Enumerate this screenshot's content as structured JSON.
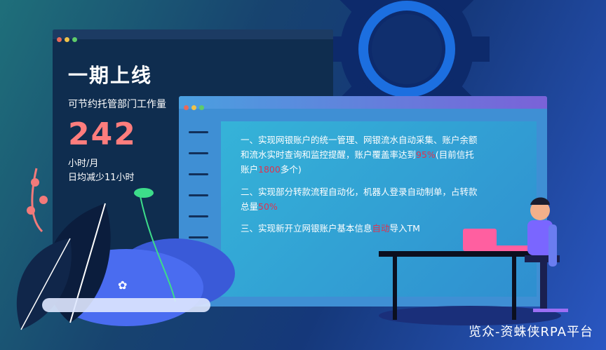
{
  "left_window": {
    "title": "一期上线",
    "subtitle": "可节约托管部门工作量",
    "big_number": "242",
    "unit": "小时/月",
    "daily": "日均减少11小时"
  },
  "right_window": {
    "item1_pre": "一、实现网银账户的统一管理、网银流水自动采集、账户余额和流水实时查询和监控提醒，账户覆盖率达到",
    "item1_hl1": "95%",
    "item1_mid": "(目前信托账户",
    "item1_hl2": "1800",
    "item1_post": "多个)",
    "item2_pre": "二、实现部分转款流程自动化，机器人登录自动制单，占转款总量",
    "item2_hl": "50%",
    "item3_pre": "三、实现新开立网银账户基本信息",
    "item3_hl": "自动",
    "item3_post": "导入TM"
  },
  "brand": "览众-资蛛侠RPA平台",
  "colors": {
    "highlight": "#e0324f",
    "big_number": "#ff7d7d",
    "gear": "#0d2a6b"
  }
}
